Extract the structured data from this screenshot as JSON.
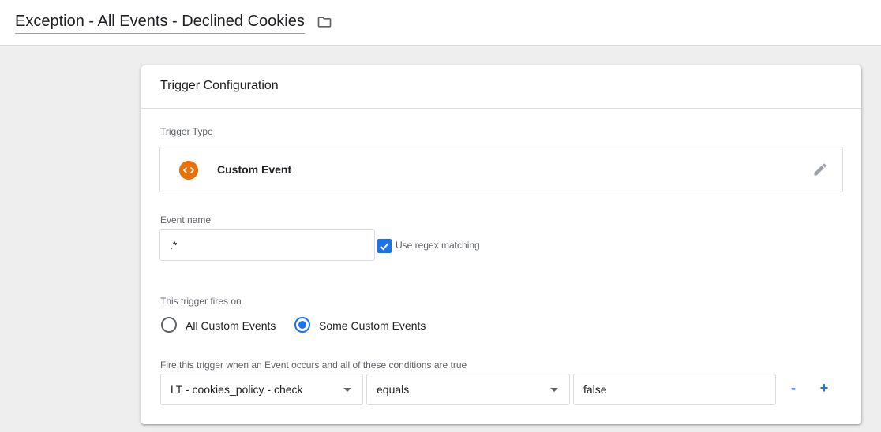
{
  "header": {
    "title": "Exception - All Events - Declined Cookies",
    "folder_icon": "folder-icon"
  },
  "card": {
    "title": "Trigger Configuration",
    "trigger_type_label": "Trigger Type",
    "trigger_type": {
      "name": "Custom Event",
      "icon": "code-brackets-icon",
      "icon_color": "#e8710a",
      "edit_icon": "pencil-icon"
    },
    "event_name_label": "Event name",
    "event_name_value": ".*",
    "regex_checkbox": {
      "label": "Use regex matching",
      "checked": true
    },
    "fires_on_label": "This trigger fires on",
    "fires_on_options": [
      {
        "label": "All Custom Events",
        "selected": false
      },
      {
        "label": "Some Custom Events",
        "selected": true
      }
    ],
    "conditions_label": "Fire this trigger when an Event occurs and all of these conditions are true",
    "condition": {
      "variable": "LT - cookies_policy - check",
      "operator": "equals",
      "value": "false",
      "remove_label": "-",
      "add_label": "+"
    }
  },
  "colors": {
    "accent": "#1a73e8",
    "trigger_icon": "#e8710a",
    "background": "#eeeeee"
  }
}
